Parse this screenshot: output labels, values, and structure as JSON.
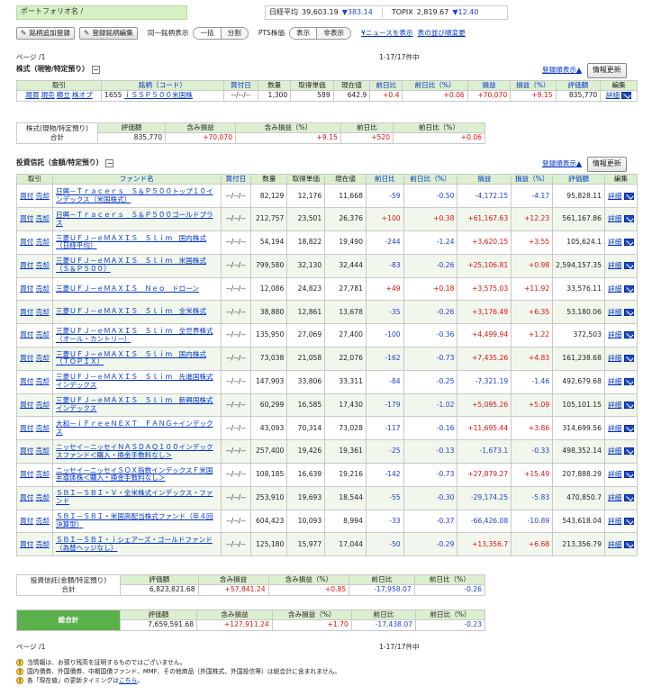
{
  "header": {
    "portfolio_label": "ポートフォリオ名 /",
    "nikkei_label": "日経平均",
    "nikkei_value": "39,603.19",
    "nikkei_change": "▼383.14",
    "topix_label": "TOPIX",
    "topix_value": "2,819.67",
    "topix_change": "▼12.40"
  },
  "toolbar": {
    "add_button": "銘柄追加登録",
    "edit_button": "登録銘柄編集",
    "same_display_label": "同一銘柄表示",
    "same_display_options": [
      "一括",
      "分割"
    ],
    "pts_label": "PTS株価",
    "pts_options": [
      "表示",
      "非表示"
    ],
    "news_link": "¥ニュースを表示",
    "sort_link": "表の並び順変更"
  },
  "pager": {
    "page": "ページ /1",
    "count": "1-17/17件中"
  },
  "stocks": {
    "title": "株式（現物/特定預り）",
    "sort_link": "登録順表示▲",
    "update_button": "情報更新",
    "columns": [
      "取引",
      "銘柄（コード）",
      "買付日",
      "数量",
      "取得単価",
      "現在値",
      "前日比",
      "前日比（%）",
      "損益",
      "損益（%）",
      "評価額",
      "編集"
    ],
    "rows": [
      {
        "actions": [
          "現買",
          "現売",
          "積立",
          "株オプ"
        ],
        "code": "1655",
        "name": "ｉＳＳＰ５００米国株",
        "date": "--/--/--",
        "qty": "1,300",
        "cost": "589",
        "price": "642.9",
        "chg": "+0.4",
        "chg_pct": "+0.06",
        "pl": "+70,070",
        "pl_pct": "+9.15",
        "value": "835,770",
        "detail": "詳細"
      }
    ],
    "summary": {
      "label1": "株式(現物/特定預り)",
      "label2": "合計",
      "headers": [
        "評価額",
        "含み損益",
        "含み損益（%）",
        "前日比",
        "前日比（%）"
      ],
      "values": [
        "835,770",
        "+70,070",
        "+9.15",
        "+520",
        "+0.06"
      ]
    }
  },
  "funds": {
    "title": "投資信託（金額/特定預り）",
    "sort_link": "登録順表示▲",
    "update_button": "情報更新",
    "columns": [
      "取引",
      "ファンド名",
      "買付日",
      "数量",
      "取得単価",
      "現在値",
      "前日比",
      "前日比（%）",
      "損益",
      "損益（%）",
      "評価額",
      "編集"
    ],
    "buy_label": "買付",
    "sell_label": "売却",
    "detail_label": "詳細",
    "rows": [
      {
        "name": "日興－Ｔｒａｃｅｒｓ　Ｓ＆Ｐ５００トップ１０インデックス（米国株式）",
        "date": "--/--/--",
        "qty": "82,129",
        "cost": "12,176",
        "price": "11,668",
        "chg": "-59",
        "chg_pct": "-0.50",
        "pl": "-4,172.15",
        "pl_pct": "-4.17",
        "value": "95,828.11"
      },
      {
        "name": "日興－Ｔｒａｃｅｒｓ　Ｓ＆Ｐ５００ゴールドプラス",
        "date": "--/--/--",
        "qty": "212,757",
        "cost": "23,501",
        "price": "26,376",
        "chg": "+100",
        "chg_pct": "+0.38",
        "pl": "+61,167.63",
        "pl_pct": "+12.23",
        "value": "561,167.86"
      },
      {
        "name": "三菱ＵＦＪ－ｅＭＡＸＩＳ　Ｓｌｉｍ　国内株式（日経平均）",
        "date": "--/--/--",
        "qty": "54,194",
        "cost": "18,822",
        "price": "19,490",
        "chg": "-244",
        "chg_pct": "-1.24",
        "pl": "+3,620.15",
        "pl_pct": "+3.55",
        "value": "105,624.1"
      },
      {
        "name": "三菱ＵＦＪ－ｅＭＡＸＩＳ　Ｓｌｉｍ　米国株式（Ｓ＆Ｐ５００）",
        "date": "--/--/--",
        "qty": "799,580",
        "cost": "32,130",
        "price": "32,444",
        "chg": "-83",
        "chg_pct": "-0.26",
        "pl": "+25,106.81",
        "pl_pct": "+0.98",
        "value": "2,594,157.35"
      },
      {
        "name": "三菱ＵＦＪ－ｅＭＡＸＩＳ　Ｎｅｏ　ドローン",
        "date": "--/--/--",
        "qty": "12,086",
        "cost": "24,823",
        "price": "27,781",
        "chg": "+49",
        "chg_pct": "+0.18",
        "pl": "+3,575.03",
        "pl_pct": "+11.92",
        "value": "33,576.11"
      },
      {
        "name": "三菱ＵＦＪ－ｅＭＡＸＩＳ　Ｓｌｉｍ　全米株式",
        "date": "--/--/--",
        "qty": "38,880",
        "cost": "12,861",
        "price": "13,678",
        "chg": "-35",
        "chg_pct": "-0.26",
        "pl": "+3,176.49",
        "pl_pct": "+6.35",
        "value": "53,180.06"
      },
      {
        "name": "三菱ＵＦＪ－ｅＭＡＸＩＳ　Ｓｌｉｍ　全世界株式（オール・カントリー）",
        "date": "--/--/--",
        "qty": "135,950",
        "cost": "27,069",
        "price": "27,400",
        "chg": "-100",
        "chg_pct": "-0.36",
        "pl": "+4,499.94",
        "pl_pct": "+1.22",
        "value": "372,503"
      },
      {
        "name": "三菱ＵＦＪ－ｅＭＡＸＩＳ　Ｓｌｉｍ　国内株式（ＴＯＰＩＸ）",
        "date": "--/--/--",
        "qty": "73,038",
        "cost": "21,058",
        "price": "22,076",
        "chg": "-162",
        "chg_pct": "-0.73",
        "pl": "+7,435.26",
        "pl_pct": "+4.83",
        "value": "161,238.68"
      },
      {
        "name": "三菱ＵＦＪ－ｅＭＡＸＩＳ　Ｓｌｉｍ　先進国株式インデックス",
        "date": "--/--/--",
        "qty": "147,903",
        "cost": "33,806",
        "price": "33,311",
        "chg": "-84",
        "chg_pct": "-0.25",
        "pl": "-7,321.19",
        "pl_pct": "-1.46",
        "value": "492,679.68"
      },
      {
        "name": "三菱ＵＦＪ－ｅＭＡＸＩＳ　Ｓｌｉｍ　新興国株式インデックス",
        "date": "--/--/--",
        "qty": "60,299",
        "cost": "16,585",
        "price": "17,430",
        "chg": "-179",
        "chg_pct": "-1.02",
        "pl": "+5,095.26",
        "pl_pct": "+5.09",
        "value": "105,101.15"
      },
      {
        "name": "大和－ｉＦｒｅｅＮＥＸＴ　ＦＡＮＧ＋インデックス",
        "date": "--/--/--",
        "qty": "43,093",
        "cost": "70,314",
        "price": "73,028",
        "chg": "-117",
        "chg_pct": "-0.16",
        "pl": "+11,695.44",
        "pl_pct": "+3.86",
        "value": "314,699.56"
      },
      {
        "name": "ニッセイ－ニッセイＮＡＳＤＡＱ１００インデックスファンド＜購入・換金手数料なし＞",
        "date": "--/--/--",
        "qty": "257,400",
        "cost": "19,426",
        "price": "19,361",
        "chg": "-25",
        "chg_pct": "-0.13",
        "pl": "-1,673.1",
        "pl_pct": "-0.33",
        "value": "498,352.14"
      },
      {
        "name": "ニッセイ－ニッセイＳＯＸ指数インデックスＦ米国半導体株＜購入・換金手数料なし＞",
        "date": "--/--/--",
        "qty": "108,185",
        "cost": "16,639",
        "price": "19,216",
        "chg": "-142",
        "chg_pct": "-0.73",
        "pl": "+27,879.27",
        "pl_pct": "+15.49",
        "value": "207,888.29"
      },
      {
        "name": "ＳＢＩ－ＳＢＩ・Ｖ・全米株式インデックス・ファンド",
        "date": "--/--/--",
        "qty": "253,910",
        "cost": "19,693",
        "price": "18,544",
        "chg": "-55",
        "chg_pct": "-0.30",
        "pl": "-29,174.25",
        "pl_pct": "-5.83",
        "value": "470,850.7"
      },
      {
        "name": "ＳＢＩ－ＳＢＩ・米国高配当株式ファンド（年４回決算型）",
        "date": "--/--/--",
        "qty": "604,423",
        "cost": "10,093",
        "price": "8,994",
        "chg": "-33",
        "chg_pct": "-0.37",
        "pl": "-66,426.08",
        "pl_pct": "-10.89",
        "value": "543,618.04"
      },
      {
        "name": "ＳＢＩ－ＳＢＩ・ｉシェアーズ・ゴールドファンド（為替ヘッジなし）",
        "date": "--/--/--",
        "qty": "125,180",
        "cost": "15,977",
        "price": "17,044",
        "chg": "-50",
        "chg_pct": "-0.29",
        "pl": "+13,356.7",
        "pl_pct": "+6.68",
        "value": "213,356.79"
      }
    ],
    "summary": {
      "label1": "投資信託(金額/特定預り)",
      "label2": "合計",
      "headers": [
        "評価額",
        "含み損益",
        "含み損益（%）",
        "前日比",
        "前日比（%）"
      ],
      "values": [
        "6,823,821.68",
        "+57,841.24",
        "+0.85",
        "-17,958.07",
        "-0.26"
      ]
    }
  },
  "total": {
    "label": "総合計",
    "headers": [
      "評価額",
      "含み損益",
      "含み損益（%）",
      "前日比",
      "前日比（%）"
    ],
    "values": [
      "7,659,591.68",
      "+127,911.24",
      "+1.70",
      "-17,438.07",
      "-0.23"
    ]
  },
  "notes": [
    "当情報は、お預り残高を証明するものではございません。",
    "国内債券、外国債券、中期国債ファンド、MMF、その他商品（外国株式、外国投信等）は総合計に含まれません。",
    "各「現在値」の更新タイミングは"
  ],
  "notes_link": "こちら",
  "notes_tail": "。",
  "colors": {
    "header_green": "#dcefd0",
    "total_green": "#5ab04a",
    "positive": "#e01010",
    "negative": "#1f3fd1",
    "link": "#0033cc"
  }
}
